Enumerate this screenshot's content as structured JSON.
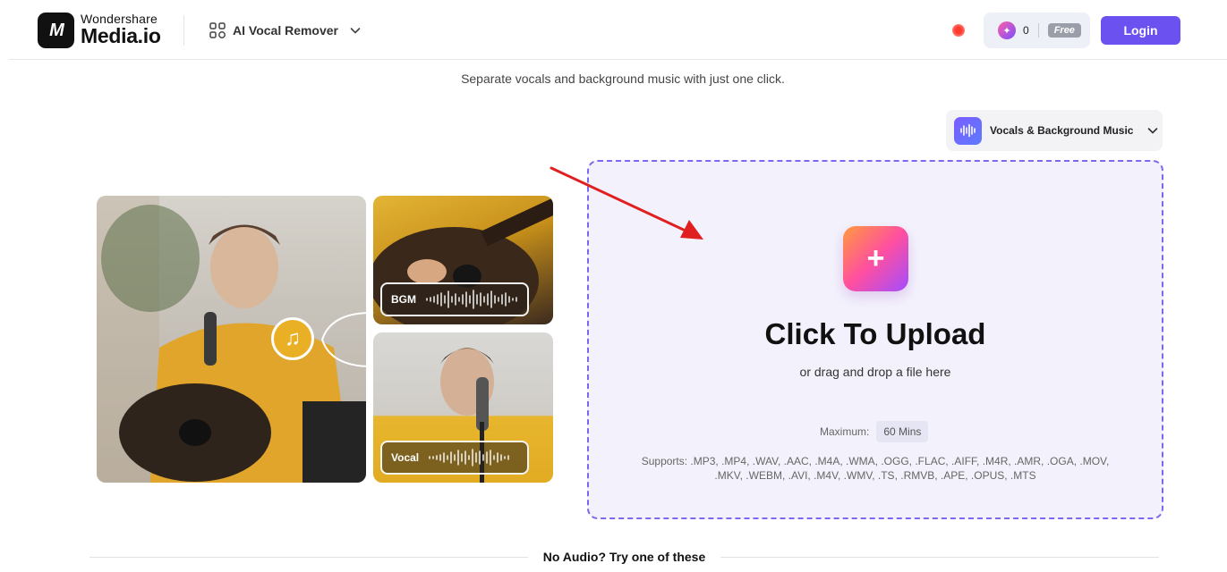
{
  "header": {
    "logo_mark": "M",
    "brand_top": "Wondershare",
    "brand_main": "Media.io",
    "tool_label": "AI Vocal Remover",
    "credits_count": "0",
    "free_badge": "Free",
    "login_label": "Login"
  },
  "subtitle": "Separate vocals and background music with just one click.",
  "mode_select": {
    "label": "Vocals & Background Music"
  },
  "preview": {
    "bgm_label": "BGM",
    "vocal_label": "Vocal"
  },
  "upload": {
    "title": "Click To Upload",
    "subtitle": "or drag and drop a file here",
    "max_label": "Maximum:",
    "max_value": "60 Mins",
    "supports": "Supports: .MP3, .MP4, .WAV, .AAC, .M4A, .WMA, .OGG, .FLAC, .AIFF, .M4R, .AMR, .OGA, .MOV, .MKV, .WEBM, .AVI, .M4V, .WMV, .TS, .RMVB, .APE, .OPUS, .MTS"
  },
  "footer": {
    "try_text": "No Audio? Try one of these"
  },
  "colors": {
    "accent": "#6a51f0",
    "annotation_arrow": "#e02020"
  }
}
